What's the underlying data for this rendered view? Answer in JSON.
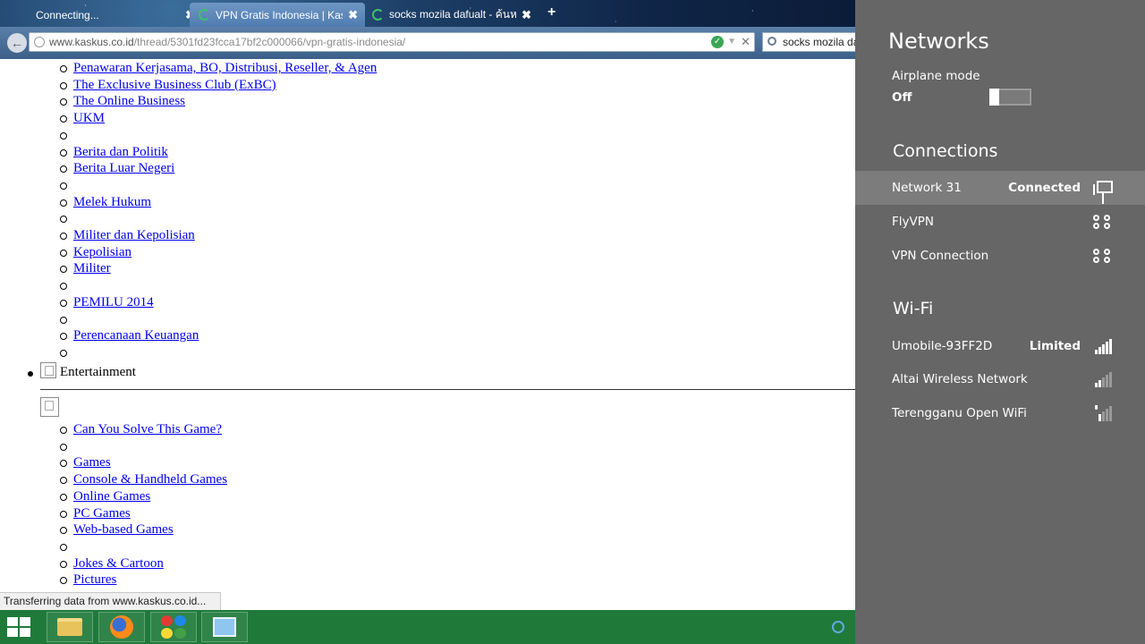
{
  "browser": {
    "tabs": [
      {
        "title": "Connecting...",
        "close": "✖"
      },
      {
        "title": "VPN Gratis Indonesia | Kask...",
        "close": "✖"
      },
      {
        "title": "socks mozila dafualt - ค้นห...",
        "close": "✖"
      }
    ],
    "new_tab": "+",
    "url_domain": "www.kaskus.co.id",
    "url_path": "/thread/5301fd23fcca17bf2c000066/vpn-gratis-indonesia/",
    "search_value": "socks mozila dafualt",
    "status_text": "Transferring data from www.kaskus.co.id..."
  },
  "page": {
    "links_top": [
      "Penawaran Kerjasama, BO, Distribusi, Reseller, & Agen",
      "The Exclusive Business Club (ExBC)",
      "The Online Business",
      "UKM",
      "",
      "Berita dan Politik",
      "Berita Luar Negeri",
      "",
      "Melek Hukum",
      "",
      "Militer dan Kepolisian",
      "Kepolisian",
      "Militer",
      "",
      "PEMILU 2014",
      "",
      "Perencanaan Keuangan",
      ""
    ],
    "entertainment_label": "Entertainment",
    "links_bottom": [
      "Can You Solve This Game?",
      "",
      "Games",
      "Console & Handheld Games",
      "Online Games",
      "PC Games",
      "Web-based Games",
      "",
      "Jokes & Cartoon",
      "Pictures"
    ]
  },
  "networks_panel": {
    "title": "Networks",
    "airplane_mode_label": "Airplane mode",
    "airplane_mode_value": "Off",
    "airplane_mode_on": false,
    "connections_title": "Connections",
    "connections": [
      {
        "name": "Network  31",
        "status": "Connected",
        "icon": "ethernet-icon"
      },
      {
        "name": "FlyVPN",
        "status": "",
        "icon": "vpn-icon"
      },
      {
        "name": "VPN Connection",
        "status": "",
        "icon": "vpn-icon"
      }
    ],
    "wifi_title": "Wi-Fi",
    "wifi": [
      {
        "name": "Umobile-93FF2D",
        "status": "Limited",
        "icon": "wifi-signal-icon",
        "bars": 5
      },
      {
        "name": "Altai Wireless Network",
        "status": "",
        "icon": "wifi-signal-icon",
        "bars": 2
      },
      {
        "name": "Terengganu Open WiFi",
        "status": "",
        "icon": "wifi-signal-secure-icon",
        "bars": 2
      }
    ]
  },
  "taskbar": {
    "apps": [
      "start-icon",
      "file-explorer-icon",
      "firefox-icon",
      "app-icon",
      "control-panel-icon"
    ]
  },
  "colors": {
    "panel_bg": "#666666",
    "selected_row": "#7c7c7c",
    "taskbar": "#1f7a3a",
    "link": "#0000ee"
  }
}
